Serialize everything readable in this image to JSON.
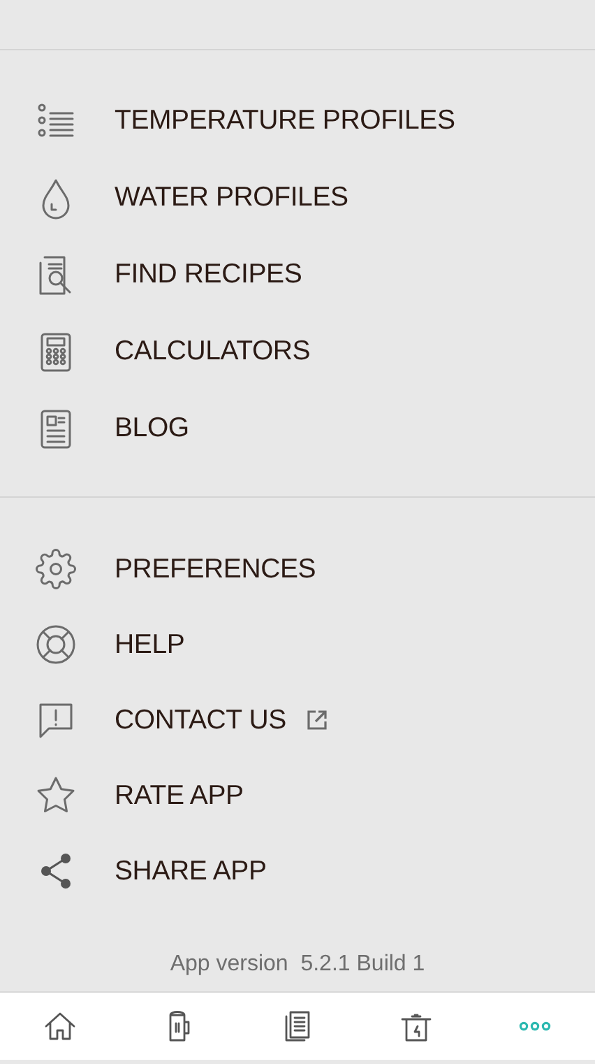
{
  "menu_sections": [
    {
      "items": [
        {
          "label": "TEMPERATURE PROFILES",
          "kind": "list",
          "external": false
        },
        {
          "label": "WATER PROFILES",
          "kind": "drop",
          "external": false
        },
        {
          "label": "FIND RECIPES",
          "kind": "search-doc",
          "external": false
        },
        {
          "label": "CALCULATORS",
          "kind": "calculator",
          "external": false
        },
        {
          "label": "BLOG",
          "kind": "newspaper",
          "external": false
        }
      ]
    },
    {
      "items": [
        {
          "label": "PREFERENCES",
          "kind": "gear",
          "external": false
        },
        {
          "label": "HELP",
          "kind": "lifebuoy",
          "external": false
        },
        {
          "label": "CONTACT US",
          "kind": "message",
          "external": true
        },
        {
          "label": "RATE APP",
          "kind": "star",
          "external": false
        },
        {
          "label": "SHARE APP",
          "kind": "share",
          "external": false
        }
      ]
    }
  ],
  "app_version": "App version  5.2.1 Build 1",
  "tab_bar": [
    {
      "kind": "home",
      "selected": false
    },
    {
      "kind": "mug",
      "selected": false
    },
    {
      "kind": "documents",
      "selected": false
    },
    {
      "kind": "kettle",
      "selected": false
    },
    {
      "kind": "more",
      "selected": true
    }
  ]
}
